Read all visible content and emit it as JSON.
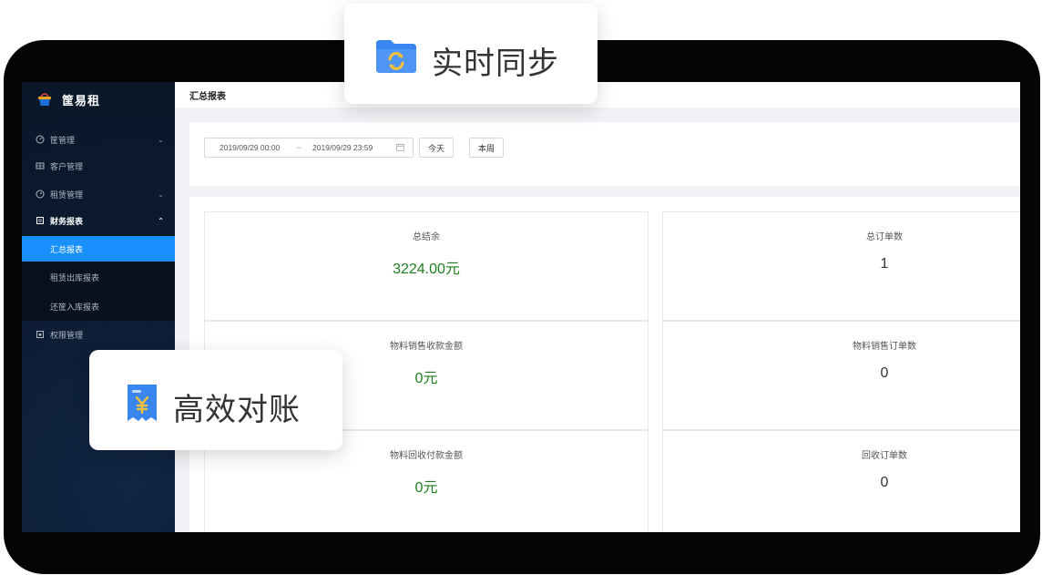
{
  "brand": {
    "name": "筐易租"
  },
  "sidebar": {
    "items": [
      {
        "label": "筐管理",
        "icon": "gauge-icon",
        "chevron": "⌄"
      },
      {
        "label": "客户管理",
        "icon": "grid-icon"
      },
      {
        "label": "租赁管理",
        "icon": "gauge-icon",
        "chevron": "⌄"
      },
      {
        "label": "财务报表",
        "icon": "report-icon",
        "chevron": "⌃"
      },
      {
        "label": "权限管理",
        "icon": "lock-box-icon"
      }
    ],
    "submenu": [
      {
        "label": "汇总报表",
        "active": true
      },
      {
        "label": "租赁出库报表"
      },
      {
        "label": "还筐入库报表"
      }
    ]
  },
  "header": {
    "title": "汇总报表"
  },
  "filter": {
    "start": "2019/09/29 00:00",
    "separator": "~",
    "end": "2019/09/29 23:59",
    "today_label": "今天",
    "week_label": "本周"
  },
  "stats": [
    {
      "label": "总结余",
      "value": "3224.00元"
    },
    {
      "label": "总订单数",
      "value": "1"
    },
    {
      "label": "物料销售收款金额",
      "value": "0元"
    },
    {
      "label": "物料销售订单数",
      "value": "0"
    },
    {
      "label": "物料回收付款金额",
      "value": "0元"
    },
    {
      "label": "回收订单数",
      "value": "0"
    }
  ],
  "badges": {
    "sync": "实时同步",
    "reconcile": "高效对账"
  },
  "colors": {
    "accent": "#1890ff",
    "sidebar": "#0e1d33",
    "money_green": "#1e7e1e"
  }
}
